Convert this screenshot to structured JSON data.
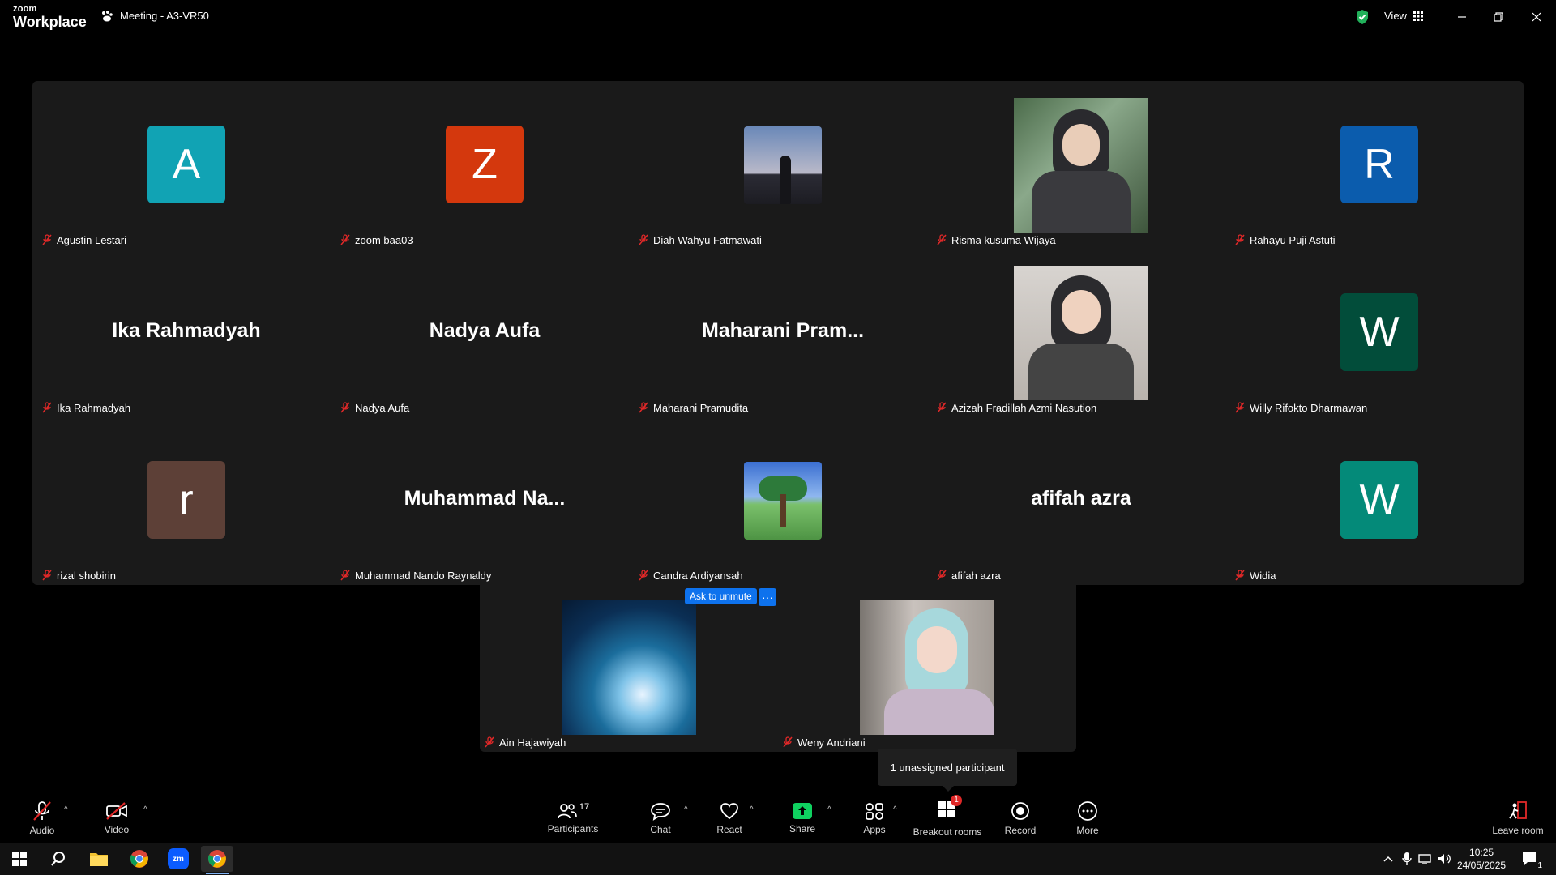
{
  "titlebar": {
    "logo_line1": "zoom",
    "logo_line2": "Workplace",
    "meeting_title": "Meeting - A3-VR50",
    "view_label": "View"
  },
  "tiles": [
    {
      "name": "Agustin Lestari",
      "type": "avatar",
      "letter": "A",
      "color": "#11a3b4"
    },
    {
      "name": "zoom baa03",
      "type": "avatar",
      "letter": "Z",
      "color": "#d4380d"
    },
    {
      "name": "Diah Wahyu Fatmawati",
      "type": "photo"
    },
    {
      "name": "Risma kusuma Wijaya",
      "type": "photo"
    },
    {
      "name": "Rahayu Puji Astuti",
      "type": "avatar",
      "letter": "R",
      "color": "#0b5cad"
    },
    {
      "name": "Ika Rahmadyah",
      "type": "text",
      "display": "Ika Rahmadyah"
    },
    {
      "name": "Nadya Aufa",
      "type": "text",
      "display": "Nadya Aufa"
    },
    {
      "name": "Maharani Pramudita",
      "type": "text",
      "display": "Maharani  Pram..."
    },
    {
      "name": "Azizah Fradillah Azmi Nasution",
      "type": "photo"
    },
    {
      "name": "Willy Rifokto Dharmawan",
      "type": "avatar",
      "letter": "W",
      "color": "#024d3a"
    },
    {
      "name": "rizal shobirin",
      "type": "avatar",
      "letter": "r",
      "color": "#5d4037"
    },
    {
      "name": "Muhammad Nando Raynaldy",
      "type": "text",
      "display": "Muhammad  Na..."
    },
    {
      "name": "Candra Ardiyansah",
      "type": "photo"
    },
    {
      "name": "afifah azra",
      "type": "text",
      "display": "afifah azra"
    },
    {
      "name": "Widia",
      "type": "avatar",
      "letter": "W",
      "color": "#048a79"
    },
    {
      "name": "Ain Hajawiyah",
      "type": "photo"
    },
    {
      "name": "Weny Andriani",
      "type": "photo"
    }
  ],
  "ask_unmute": "Ask to unmute",
  "ask_more": "···",
  "tooltip": "1 unassigned participant",
  "toolbar": {
    "audio": "Audio",
    "video": "Video",
    "participants": "Participants",
    "participants_count": "17",
    "chat": "Chat",
    "react": "React",
    "share": "Share",
    "apps": "Apps",
    "breakout": "Breakout rooms",
    "breakout_badge": "1",
    "record": "Record",
    "more": "More",
    "leave": "Leave room"
  },
  "taskbar": {
    "time": "10:25",
    "date": "24/05/2025",
    "notif_count": "1"
  },
  "colors": {
    "accent": "#0e72ed",
    "share_green": "#0fd160",
    "mute_red": "#e02828",
    "gallery_bg": "#1a1a1a"
  }
}
